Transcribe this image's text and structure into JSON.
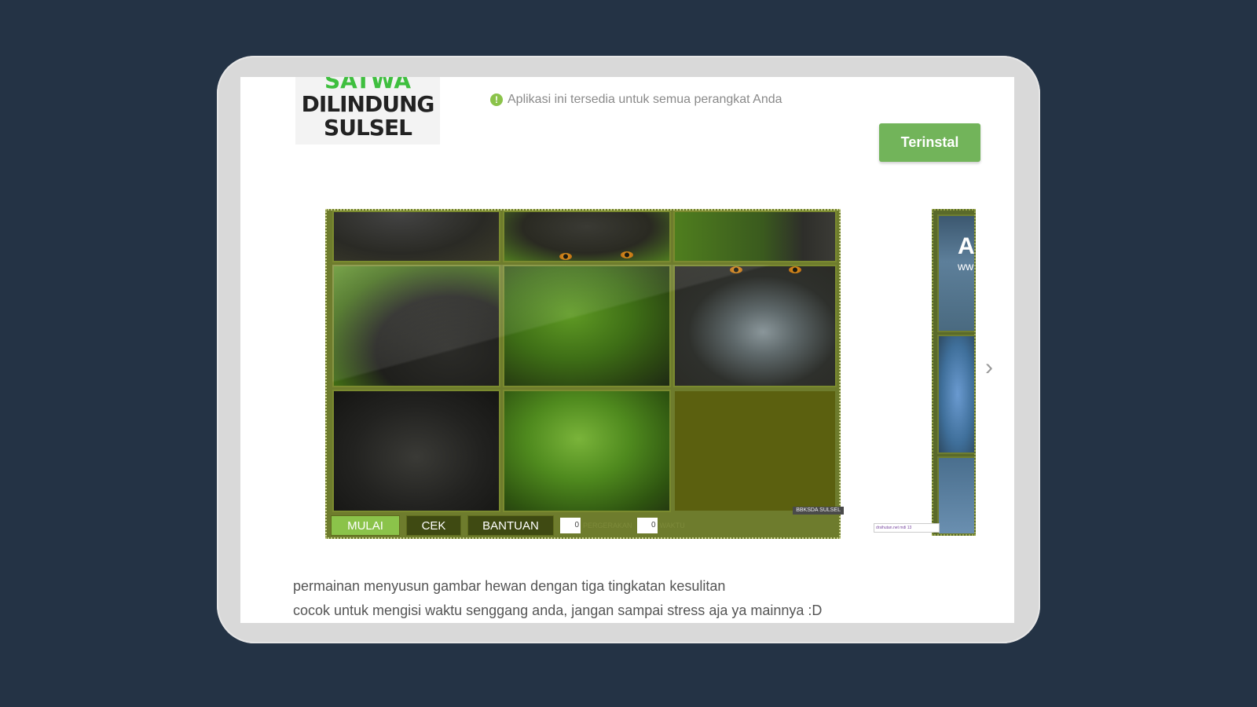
{
  "app": {
    "logo": {
      "line1": "SATWA",
      "line2": "DILINDUNG",
      "line3": "SULSEL"
    },
    "notice": "Aplikasi ini tersedia untuk semua perangkat Anda",
    "install_label": "Terinstal"
  },
  "game": {
    "watermark": "BBKSDA SULSEL",
    "buttons": {
      "start": "MULAI",
      "check": "CEK",
      "help": "BANTUAN"
    },
    "moves_value": "0",
    "moves_label": "PERGERAKAN",
    "time_value": "0",
    "time_label": "WAKTU"
  },
  "side_preview": {
    "letter": "A",
    "www": "ww",
    "tag": "drsihutan.net mdi 13"
  },
  "description": {
    "line1": "permainan menyusun gambar hewan dengan tiga tingkatan kesulitan",
    "line2": "cocok untuk mengisi waktu senggang anda, jangan sampai stress aja ya mainnya :D"
  },
  "colors": {
    "background": "#243345",
    "accent_green": "#72b45a",
    "puzzle_frame": "#6e7c2d"
  },
  "icons": {
    "info": "info-icon",
    "next": "chevron-right-icon"
  }
}
